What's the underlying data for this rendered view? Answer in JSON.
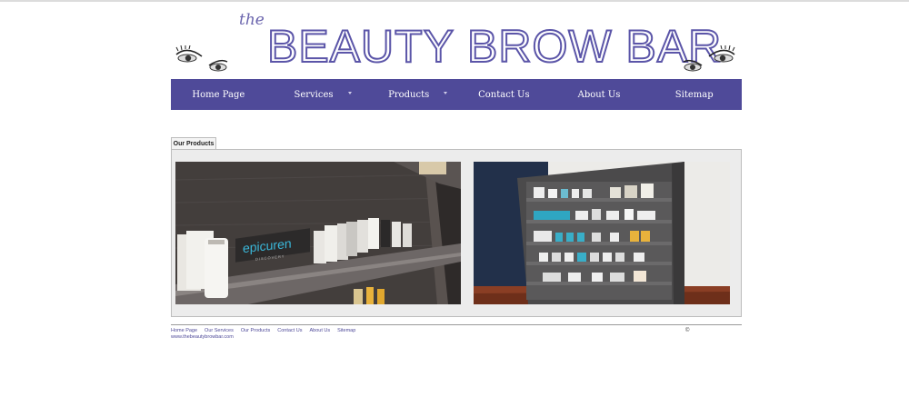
{
  "header": {
    "the": "the",
    "brand": "BEAUTY BROW BAR"
  },
  "nav": {
    "items": [
      {
        "label": "Home Page",
        "has_dropdown": false
      },
      {
        "label": "Services",
        "has_dropdown": true
      },
      {
        "label": "Products",
        "has_dropdown": true
      },
      {
        "label": "Contact Us",
        "has_dropdown": false
      },
      {
        "label": "About Us",
        "has_dropdown": false
      },
      {
        "label": "Sitemap",
        "has_dropdown": false
      }
    ]
  },
  "tab": {
    "label": "Our Products"
  },
  "photos": {
    "left_sign": "epicuren",
    "left_sign_sub": "DISCOVERY"
  },
  "footer": {
    "links": [
      "Home Page",
      "Our Services",
      "Our Products",
      "Contact Us",
      "About Us",
      "Sitemap"
    ],
    "url": "www.thebeautybrowbar.com",
    "copyright": "©"
  },
  "colors": {
    "nav_bg": "#4f4a99",
    "brand_stroke": "#5b55a8",
    "link": "#4f4a99"
  }
}
